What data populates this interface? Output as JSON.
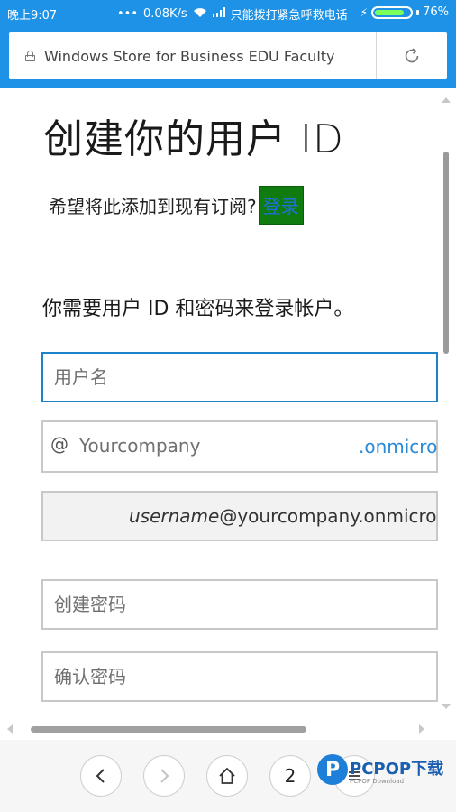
{
  "status_bar": {
    "time": "晚上9:07",
    "network_speed": "0.08K/s",
    "carrier": "只能拨打紧急呼救电话",
    "battery": "76%"
  },
  "address_bar": {
    "url_title": "Windows Store for Business EDU Faculty",
    "reload_icon": "refresh-icon"
  },
  "page": {
    "title": "创建你的用户 ID",
    "subscribe_prompt": "希望将此添加到现有订阅?",
    "signin_label": "登录",
    "info_text": "你需要用户 ID 和密码来登录帐户。",
    "username_placeholder": "用户名",
    "domain_at": "@",
    "domain_placeholder": "Yourcompany",
    "domain_suffix": ".onmicro",
    "preview_italic": "username",
    "preview_rest": "@yourcompany.onmicros",
    "password_placeholder": "创建密码",
    "confirm_placeholder": "确认密码"
  },
  "nav": {
    "tab_count": "2"
  },
  "watermark": {
    "logo": "P",
    "name": "PCPOP下载",
    "sub": "PCPOP Download"
  },
  "colors": {
    "accent": "#1e92e6",
    "signin_bg": "#107c10",
    "focus_border": "#1e82c8"
  }
}
